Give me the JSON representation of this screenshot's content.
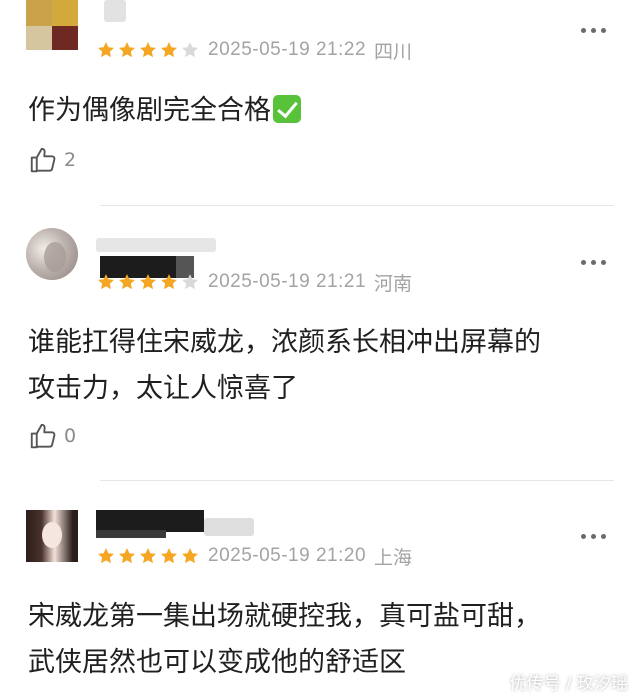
{
  "comments": [
    {
      "rating": 4,
      "timestamp": "2025-05-19 21:22",
      "location": "四川",
      "text": "作为偶像剧完全合格",
      "emoji_icon": "check-mark-emoji",
      "likes": "2"
    },
    {
      "rating": 4,
      "timestamp": "2025-05-19 21:21",
      "location": "河南",
      "text_lines": [
        "谁能扛得住宋威龙，浓颜系长相冲出屏幕的",
        "攻击力，太让人惊喜了"
      ],
      "likes": "0"
    },
    {
      "rating": 5,
      "timestamp": "2025-05-19 21:20",
      "location": "上海",
      "text_lines": [
        "宋威龙第一集出场就硬控我，真可盐可甜，",
        "武侠居然也可以变成他的舒适区"
      ]
    }
  ],
  "watermark": "优传号 / 玫汐瑶",
  "colors": {
    "star_filled": "#f5a623",
    "star_empty": "#d9d9d9",
    "meta_text": "#a3a3a3"
  }
}
